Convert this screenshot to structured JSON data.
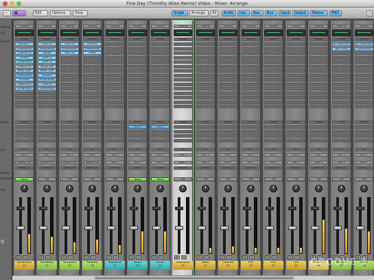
{
  "window": {
    "title": "Fine Day (Timothy Allan Remix) Video - Mixer: Arrange"
  },
  "toolbar": {
    "edit": "Edit",
    "options": "Options",
    "view": "View",
    "views": [
      "Single",
      "Arrange",
      "All"
    ],
    "filters": [
      "Audio",
      "Inst",
      "Aux",
      "Bus",
      "Input",
      "Output",
      "Master",
      "MIDI"
    ]
  },
  "left_labels": {
    "setting": "Setting",
    "eq": "EQ",
    "inserts": "Inserts",
    "sends": "Sends",
    "io": "I/O",
    "group": "Group",
    "automation": "Automation",
    "pan": "Pan",
    "db": "dB"
  },
  "colors": {
    "selected_outline": "#6fe36f",
    "plugin": "#9fd0f0",
    "read": "#8ad86b"
  },
  "channels": [
    {
      "name": "Synthesizer",
      "num": "22",
      "color": "c-yellow",
      "inserts": [
        "Retune 3",
        "Multipressor",
        "Channel EQ",
        "EnVerb",
        "Compressor",
        "Channel EQ",
        "Noise Gate",
        "AUBandpass",
        "AUDelay",
        "Channel EQ",
        "Compressor"
      ],
      "sends": [],
      "io_in": "Bus 1",
      "io_out": "Stereo Out",
      "group": "Audio 22",
      "auto": "Read",
      "vol": "-5.2",
      "meter": 0.35
    },
    {
      "name": "MonoBass",
      "num": "24",
      "color": "c-green",
      "inserts": [
        "Chan EQ",
        "Multipressor",
        "Flanger",
        "Chan EQ",
        "Chan EQ",
        "Space Des",
        "Noise Gate",
        "AUBand",
        "Multipressor",
        "Chan EQ",
        "Compressor"
      ],
      "sends": [],
      "io_in": "Bus 1",
      "io_out": "Stereo Out",
      "group": "Audio 24",
      "auto": "Off",
      "vol": "-3.4",
      "meter": 0.3
    },
    {
      "name": "Mixapiano",
      "num": "25",
      "color": "c-green",
      "inserts": [
        "Chan EQ",
        "Multipressor",
        "Low Cut"
      ],
      "sends": [],
      "io_in": "Bus 1",
      "io_out": "Stereo Out",
      "group": "Audio 25",
      "auto": "Off",
      "vol": "-7.1",
      "meter": 0.2
    },
    {
      "name": "Mellbass",
      "num": "26",
      "color": "c-green",
      "inserts": [
        "Chan EQ",
        "Multipressor",
        "Delay"
      ],
      "sends": [],
      "io_in": "Bus 1",
      "io_out": "Stereo Out",
      "group": "Audio 26",
      "auto": "Off",
      "vol": "-4.8",
      "meter": 0.25
    },
    {
      "name": "AltoDaniel",
      "num": "27",
      "color": "c-teal",
      "inserts": [],
      "sends": [],
      "io_in": "Bus 1",
      "io_out": "Bus 3",
      "group": "Audio 14",
      "auto": "Off",
      "vol": "-12.3",
      "meter": 0.15
    },
    {
      "name": "Vocals",
      "num": "28",
      "color": "c-teal",
      "inserts": [],
      "sends": [
        "Bus 5"
      ],
      "io_in": "Bus 1",
      "io_out": "Bus 3",
      "group": "Audio 4",
      "auto": "Read",
      "vol": "-2.9",
      "meter": 0.4
    },
    {
      "name": "Vocal2",
      "num": "29",
      "color": "c-teal",
      "inserts": [],
      "sends": [
        "Bus 5"
      ],
      "io_in": "Bus 1",
      "io_out": "Bus 3",
      "group": "Audio 4",
      "auto": "Read",
      "vol": "-2.9",
      "meter": 0.4
    },
    {
      "name": "Guitaroom",
      "num": "30",
      "color": "c-yellow",
      "inserts": [],
      "sends": [],
      "io_in": "Bus 1",
      "io_out": "Bus 3",
      "group": "Audio 4",
      "auto": "Off",
      "vol": "0.0",
      "meter": 0.0,
      "selected": true
    },
    {
      "name": "Noise",
      "num": "31",
      "color": "c-yellow",
      "inserts": [],
      "sends": [],
      "io_in": "Bus 1",
      "io_out": "Bus 3",
      "group": "Audio 4",
      "auto": "Off",
      "vol": "-6.6",
      "meter": 0.1
    },
    {
      "name": "Claverist",
      "num": "32",
      "color": "c-yellow",
      "inserts": [],
      "sends": [],
      "io_in": "Bus 1",
      "io_out": "Bus 3",
      "group": "Audio 12",
      "auto": "Off",
      "vol": "-8.0",
      "meter": 0.12
    },
    {
      "name": "FX1",
      "num": "33",
      "color": "c-yellow",
      "inserts": [],
      "sends": [],
      "io_in": "Bus 1",
      "io_out": "Bus 3",
      "group": "Audio 13",
      "auto": "Off",
      "vol": "-5.5",
      "meter": 0.1
    },
    {
      "name": "FX2",
      "num": "34",
      "color": "c-yellow",
      "inserts": [],
      "sends": [],
      "io_in": "Bus 1",
      "io_out": "Bus 3",
      "group": "Audio 24",
      "auto": "Off",
      "vol": "-9.3",
      "meter": 0.1
    },
    {
      "name": "FX3",
      "num": "35",
      "color": "c-yellow",
      "inserts": [],
      "sends": [],
      "io_in": "Bus 1",
      "io_out": "Bus 3",
      "group": "Audio 24",
      "auto": "Off",
      "vol": "-4.2",
      "meter": 0.1
    },
    {
      "name": "Sidechain",
      "num": "36",
      "color": "c-pale",
      "inserts": [],
      "sends": [],
      "io_in": "Bus 1",
      "io_out": "Bus 3",
      "group": "Audio 25",
      "auto": "Off",
      "vol": "-3.0",
      "meter": 0.6
    },
    {
      "name": "Big Verb",
      "num": "37",
      "color": "c-green",
      "inserts": [
        "AU Sidechain",
        "Tape Delay"
      ],
      "sends": [],
      "io_in": "Bus 1",
      "io_out": "Bus 3",
      "group": "Audio 21",
      "auto": "Off",
      "vol": "-2.5",
      "meter": 0.45
    },
    {
      "name": "Chord",
      "num": "38",
      "color": "c-green",
      "inserts": [
        "AU Sidechain",
        "Compressor"
      ],
      "sends": [],
      "io_in": "Bus 1",
      "io_out": "Bus 3",
      "group": "Audio 21",
      "auto": "Off",
      "vol": "-2.5",
      "meter": 0.4
    }
  ],
  "watermark": "GROOVE 3"
}
